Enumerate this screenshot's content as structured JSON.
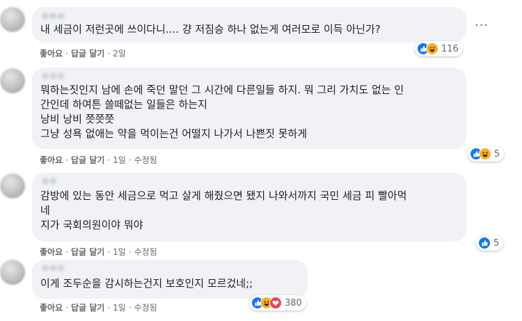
{
  "comments": [
    {
      "text": "내 세금이 저런곳에 쓰이다니.... 걍 저짐승 하나 없는게 여러모로 이득 아닌가?",
      "actions": {
        "like": "좋아요",
        "reply": "답글 달기",
        "time": "2일",
        "edited": ""
      },
      "reactions": {
        "icons": [
          "like-icon",
          "haha-icon"
        ],
        "count": "116"
      }
    },
    {
      "text": "뭐하는짓인지 남에 손에 죽던 말던 그 시간에 다른일들 하지. 뭐 그리 가치도 없는 인\n간인데 하여튼 쓸떼없는 일들은 하는지\n낭비 낭비 쯧쯧쯧\n그냥 성욕 없애는 약을 먹이는건 어떨지 나가서 나쁜짓 못하게",
      "actions": {
        "like": "좋아요",
        "reply": "답글 달기",
        "time": "1일",
        "edited": "수정됨"
      },
      "reactions": {
        "icons": [
          "like-icon",
          "haha-icon"
        ],
        "count": "5"
      }
    },
    {
      "text": "감방에 있는 동안 세금으로 먹고 살게 해줬으면 됐지 나와서까지 국민 세금 피 빨아먹\n네\n지가 국회의원이야 뭐야",
      "actions": {
        "like": "좋아요",
        "reply": "답글 달기",
        "time": "1일",
        "edited": "수정됨"
      },
      "reactions": {
        "icons": [
          "like-icon"
        ],
        "count": "5"
      }
    },
    {
      "text": "이게 조두순을 감시하는건지 보호인지 모르겄네;;",
      "actions": {
        "like": "좋아요",
        "reply": "답글 달기",
        "time": "1일",
        "edited": "수정됨"
      },
      "reactions": {
        "icons": [
          "like-icon",
          "haha-icon",
          "love-icon"
        ],
        "count": "380"
      }
    }
  ],
  "more_menu": "···",
  "colors": {
    "bubble": "#f0f2f5",
    "meta": "#65676b",
    "like": "#1877f2",
    "haha": "#f7b125",
    "love": "#f33e58"
  }
}
